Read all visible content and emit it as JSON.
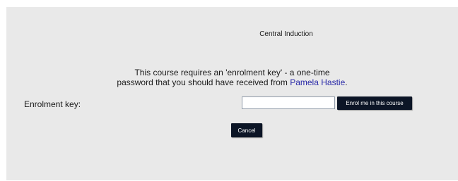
{
  "course": {
    "title": "Central Induction"
  },
  "message": {
    "line1": "This course requires an 'enrolment key' - a one-time",
    "line2_prefix": "password that you should have received from ",
    "teacher_name": "Pamela Hastie",
    "line2_suffix": "."
  },
  "form": {
    "key_label": "Enrolment key:",
    "key_value": "",
    "key_placeholder": "",
    "enrol_button_label": "Enrol me in this course",
    "cancel_button_label": "Cancel"
  },
  "colors": {
    "panel_background": "#e9e9e9",
    "button_background": "#0c1526",
    "link": "#2a2aa8"
  }
}
